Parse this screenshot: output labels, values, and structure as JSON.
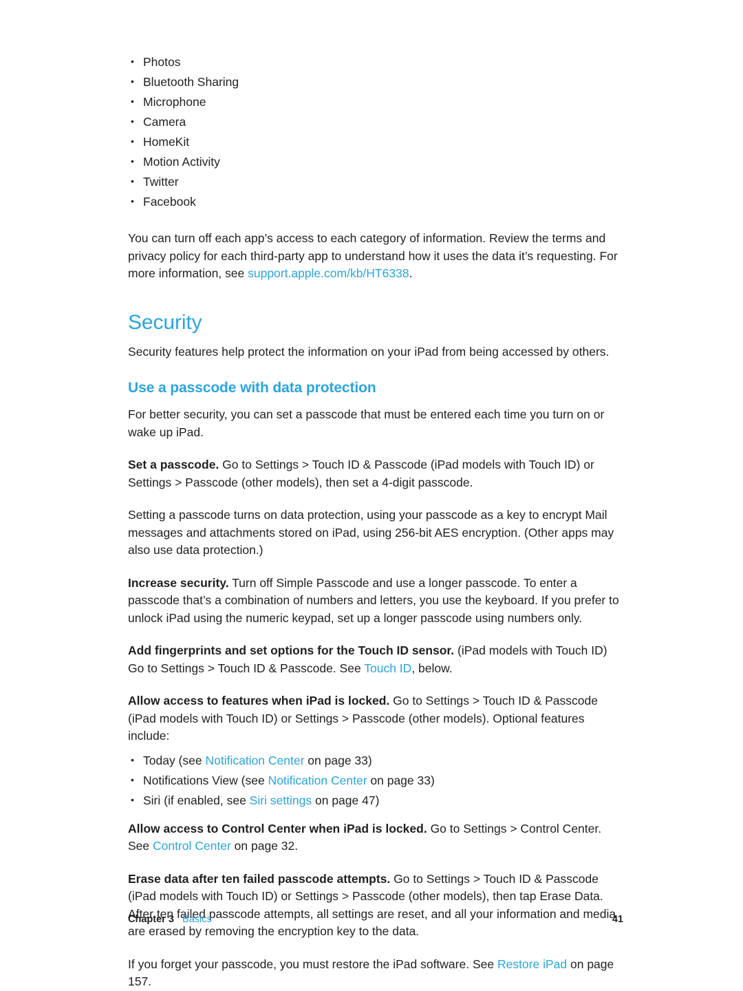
{
  "document": {
    "permissions_list": [
      "Photos",
      "Bluetooth Sharing",
      "Microphone",
      "Camera",
      "HomeKit",
      "Motion Activity",
      "Twitter",
      "Facebook"
    ],
    "intro_paragraph": {
      "text_before": "You can turn off each app’s access to each category of information. Review the terms and privacy policy for each third-party app to understand how it uses the data it’s requesting. For more information, see ",
      "link": "support.apple.com/kb/HT6338",
      "text_after": "."
    },
    "security_heading": "Security",
    "security_intro": "Security features help protect the information on your iPad from being accessed by others.",
    "passcode_heading": "Use a passcode with data protection",
    "passcode_intro": "For better security, you can set a passcode that must be entered each time you turn on or wake up iPad.",
    "set_passcode": {
      "lead": "Set a passcode.",
      "text": " Go to Settings > Touch ID & Passcode (iPad models with Touch ID) or Settings > Passcode (other models), then set a 4-digit passcode."
    },
    "data_protection_paragraph": "Setting a passcode turns on data protection, using your passcode as a key to encrypt Mail messages and attachments stored on iPad, using 256-bit AES encryption. (Other apps may also use data protection.)",
    "increase_security": {
      "lead": "Increase security.",
      "text": " Turn off Simple Passcode and use a longer passcode. To enter a passcode that’s a combination of numbers and letters, you use the keyboard. If you prefer to unlock iPad using the numeric keypad, set up a longer passcode using numbers only."
    },
    "fingerprints": {
      "lead": "Add fingerprints and set options for the Touch ID sensor.",
      "text_before": " (iPad models with Touch ID) Go to Settings > Touch ID & Passcode. See ",
      "link": "Touch ID",
      "text_after": ", below."
    },
    "allow_locked": {
      "lead": "Allow access to features when iPad is locked.",
      "text": " Go to Settings > Touch ID & Passcode (iPad models with Touch ID) or Settings > Passcode (other models). Optional features include:"
    },
    "locked_features": [
      {
        "before": "Today (see ",
        "link": "Notification Center",
        "after": " on page 33)"
      },
      {
        "before": "Notifications View (see ",
        "link": "Notification Center",
        "after": " on page 33)"
      },
      {
        "before": "Siri (if enabled, see ",
        "link": "Siri settings",
        "after": " on page 47)"
      }
    ],
    "control_center": {
      "lead": "Allow access to Control Center when iPad is locked.",
      "text_before": " Go to Settings > Control Center. See ",
      "link": "Control Center",
      "text_after": " on page 32."
    },
    "erase_data": {
      "lead": "Erase data after ten failed passcode attempts.",
      "text": " Go to Settings > Touch ID & Passcode (iPad models with Touch ID) or Settings > Passcode (other models), then tap Erase Data. After ten failed passcode attempts, all settings are reset, and all your information and media are erased by removing the encryption key to the data."
    },
    "forgot_passcode": {
      "text_before": "If you forget your passcode, you must restore the iPad software. See ",
      "link": "Restore iPad",
      "text_after": " on page 157."
    },
    "footer": {
      "chapter_label": "Chapter  3",
      "chapter_name": "Basics",
      "page_number": "41"
    },
    "colors": {
      "link": "#2aa5dd",
      "text": "#221f1f"
    }
  }
}
